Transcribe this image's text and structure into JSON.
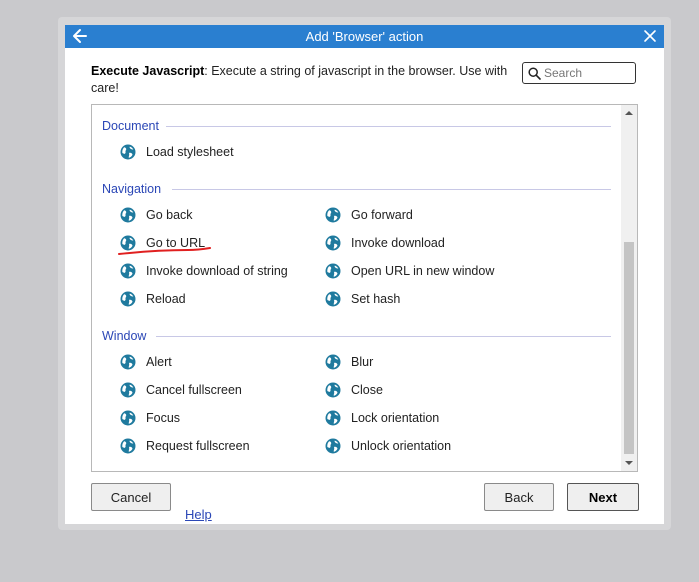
{
  "window": {
    "title": "Add 'Browser' action",
    "back_icon": "arrow-left-icon",
    "close_icon": "close-icon"
  },
  "description": {
    "name": "Execute Javascript",
    "text": ": Execute a string of javascript in the browser. Use with care!"
  },
  "search": {
    "placeholder": "Search",
    "value": "",
    "icon": "search-icon"
  },
  "sections": {
    "document": {
      "title": "Document",
      "items": [
        "Load stylesheet"
      ]
    },
    "navigation": {
      "title": "Navigation",
      "items": [
        "Go back",
        "Go forward",
        "Go to URL",
        "Invoke download",
        "Invoke download of string",
        "Open URL in new window",
        "Reload",
        "Set hash"
      ]
    },
    "window": {
      "title": "Window",
      "items": [
        "Alert",
        "Blur",
        "Cancel fullscreen",
        "Close",
        "Focus",
        "Lock orientation",
        "Request fullscreen",
        "Unlock orientation"
      ]
    }
  },
  "item_icon": "globe-icon",
  "buttons": {
    "cancel": "Cancel",
    "help": "Help",
    "back": "Back",
    "next": "Next"
  },
  "colors": {
    "titlebar": "#2a7fd0",
    "section_title": "#2b47b6",
    "globe": "#1f7a9e",
    "annotation": "#e02020"
  }
}
